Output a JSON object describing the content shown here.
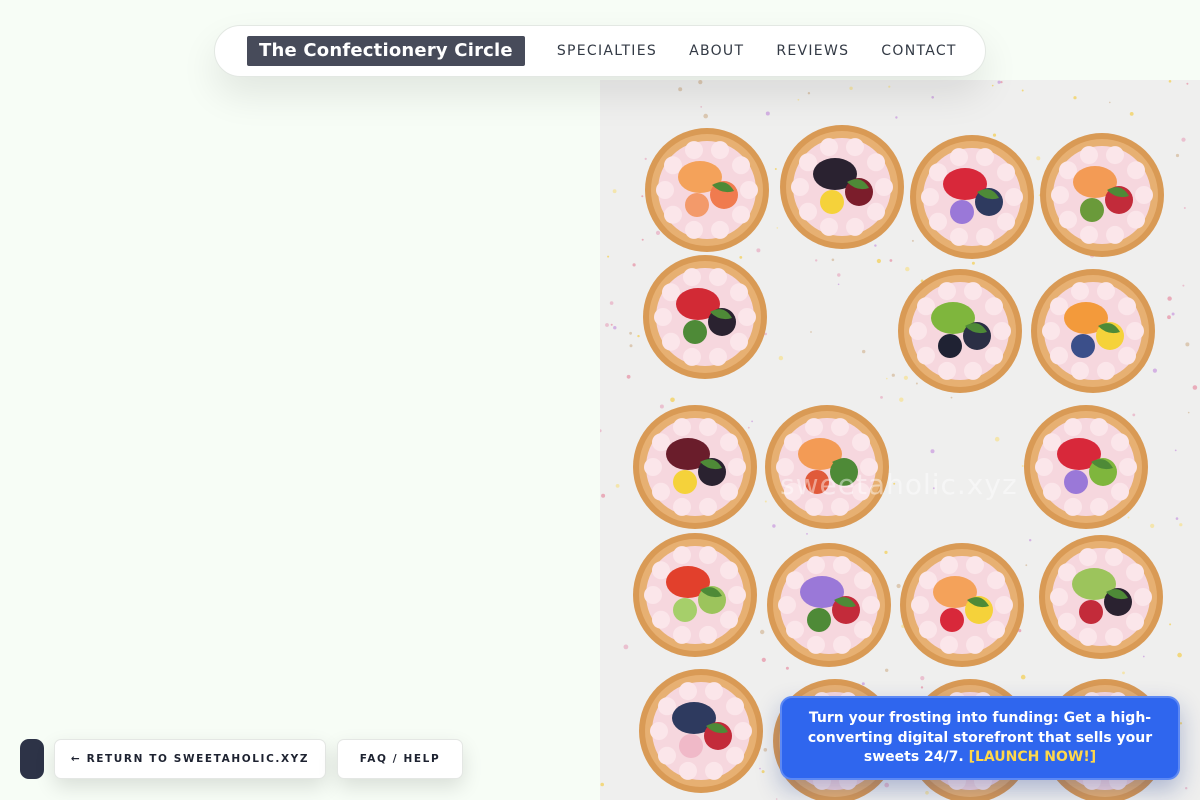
{
  "nav": {
    "brand": "The Confectionery Circle",
    "links": [
      "SPECIALTIES",
      "ABOUT",
      "REVIEWS",
      "CONTACT"
    ]
  },
  "hero": {
    "watermark": "sweetaholic.xyz"
  },
  "buttons": {
    "return": "← RETURN TO SWEETAHOLIC.XYZ",
    "faq": "FAQ / HELP"
  },
  "promo": {
    "text": "Turn your frosting into funding: Get a high-converting digital storefront that sells your sweets 24/7.",
    "cta": "[LAUNCH NOW!]"
  },
  "colors": {
    "page_background": "#f7fdf6",
    "brand_background": "#474b5a",
    "promo_background": "#2f66ee",
    "promo_cta": "#ffd84a"
  }
}
